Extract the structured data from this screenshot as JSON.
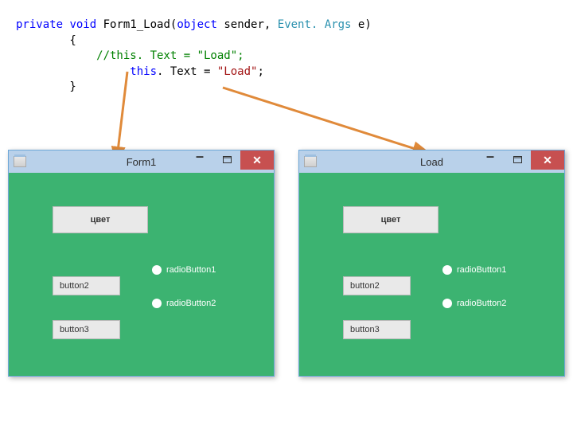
{
  "code": {
    "kw_private": "private",
    "kw_void": "void",
    "method": " Form1_Load(",
    "kw_object": "object",
    "after_object": " sender, ",
    "type_eventargs": "Event. Args",
    "after_eventargs": " e)",
    "brace_open": "        {",
    "comment_line": "            //this. Text = \"Load\";",
    "indent_assign": "                 ",
    "kw_this": "this",
    "assign_mid": ". Text = ",
    "str_load": "\"Load\"",
    "assign_end": ";",
    "brace_close": "        }"
  },
  "windows": {
    "left": {
      "title": "Form1",
      "controls": {
        "btn_cvet": "цвет",
        "btn2": "button2",
        "btn3": "button3",
        "radio1": "radioButton1",
        "radio2": "radioButton2"
      }
    },
    "right": {
      "title": "Load",
      "controls": {
        "btn_cvet": "цвет",
        "btn2": "button2",
        "btn3": "button3",
        "radio1": "radioButton1",
        "radio2": "radioButton2"
      }
    }
  }
}
